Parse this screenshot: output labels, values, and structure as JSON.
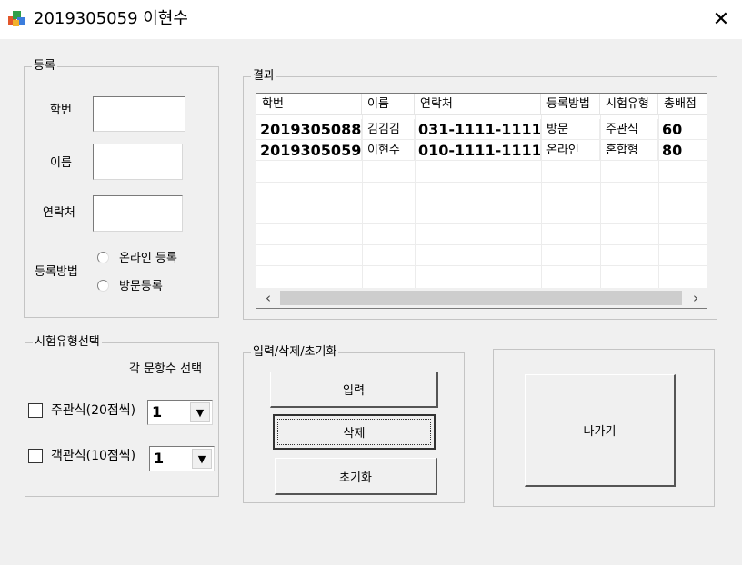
{
  "window": {
    "title": "2019305059 이현수",
    "close_glyph": "✕"
  },
  "registration": {
    "legend": "등록",
    "student_id_label": "학번",
    "name_label": "이름",
    "contact_label": "연락처",
    "method_label": "등록방법",
    "student_id_value": "",
    "name_value": "",
    "contact_value": "",
    "options": [
      "온라인 등록",
      "방문등록"
    ]
  },
  "results": {
    "legend": "결과",
    "columns": [
      "학번",
      "이름",
      "연락처",
      "등록방법",
      "시험유형",
      "총배점"
    ],
    "rows": [
      [
        "2019305088",
        "김김김",
        "031-1111-1111",
        "방문",
        "주관식",
        "60"
      ],
      [
        "2019305059",
        "이현수",
        "010-1111-1111",
        "온라인",
        "혼합형",
        "80"
      ]
    ],
    "scroll_left": "‹",
    "scroll_right": "›"
  },
  "exam_type": {
    "legend": "시험유형선택",
    "subtitle": "각 문항수 선택",
    "subjective_label": "주관식(20점씩)",
    "objective_label": "객관식(10점씩)",
    "subjective_count": "1",
    "objective_count": "1"
  },
  "actions": {
    "legend": "입력/삭제/초기화",
    "input_label": "입력",
    "delete_label": "삭제",
    "reset_label": "초기화"
  },
  "exit": {
    "label": "나가기"
  },
  "icons": {
    "app": "app-icon",
    "radio": "radio-icon",
    "checkbox": "checkbox-icon",
    "dropdown": "▼"
  }
}
